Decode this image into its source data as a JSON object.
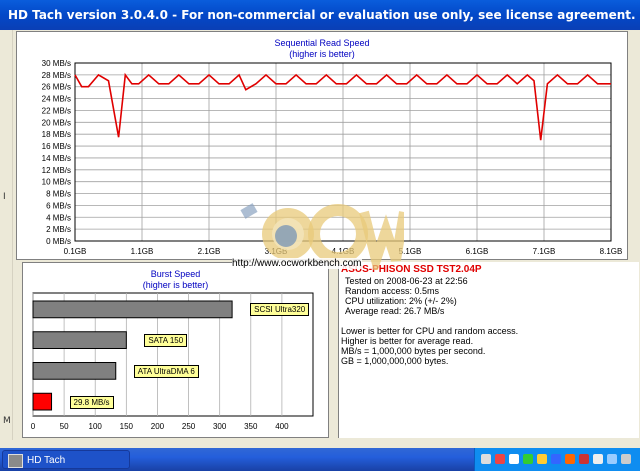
{
  "window": {
    "title": "HD Tach version 3.0.4.0  - For non-commercial or evaluation use only, see license agreement."
  },
  "left_letters": [
    "I",
    "M"
  ],
  "read_chart": {
    "title_line1": "Sequential Read Speed",
    "title_line2": "(higher is better)"
  },
  "burst_chart": {
    "title_line1": "Burst Speed",
    "title_line2": "(higher is better)"
  },
  "info": {
    "drive": "ASUS-PHISON SSD TST2.04P",
    "tested": "Tested on 2008-06-23 at 22:56",
    "random_access": "Random access: 0.5ms",
    "cpu": "CPU utilization: 2% (+/- 2%)",
    "avg_read": "Average read: 26.7 MB/s",
    "note1": "Lower is better for CPU and random access.",
    "note2": "Higher is better for average read.",
    "note3": "MB/s = 1,000,000 bytes per second.",
    "note4": "GB = 1,000,000,000 bytes."
  },
  "watermark": {
    "logo_text": "OCW",
    "url": "http://www.ocworkbench.com"
  },
  "taskbar": {
    "task_label": "HD Tach"
  },
  "colors": {
    "read_line": "#e00000",
    "bar_fill": "#808080",
    "burst_bar": "#ff0000",
    "title_blue": "#0000c0"
  },
  "chart_data": [
    {
      "type": "line",
      "title": "Sequential Read Speed",
      "subtitle": "(higher is better)",
      "ylim": [
        0,
        30
      ],
      "y_ticks": [
        "0 MB/s",
        "2 MB/s",
        "4 MB/s",
        "6 MB/s",
        "8 MB/s",
        "10 MB/s",
        "12 MB/s",
        "14 MB/s",
        "16 MB/s",
        "18 MB/s",
        "20 MB/s",
        "22 MB/s",
        "24 MB/s",
        "26 MB/s",
        "28 MB/s",
        "30 MB/s"
      ],
      "x_ticks": [
        "0.1GB",
        "1.1GB",
        "2.1GB",
        "3.1GB",
        "4.1GB",
        "5.1GB",
        "6.1GB",
        "7.1GB",
        "8.1GB"
      ],
      "xlim": [
        0.1,
        8.1
      ],
      "grid": true,
      "series": [
        {
          "x": [
            0.1,
            0.2,
            0.3,
            0.45,
            0.6,
            0.75,
            0.85,
            0.95,
            1.05,
            1.2,
            1.35,
            1.5,
            1.65,
            1.8,
            1.95,
            2.1,
            2.25,
            2.4,
            2.55,
            2.65,
            2.8,
            2.95,
            3.1,
            3.25,
            3.4,
            3.55,
            3.7,
            3.85,
            4.0,
            4.15,
            4.3,
            4.45,
            4.6,
            4.75,
            4.9,
            5.05,
            5.2,
            5.35,
            5.5,
            5.65,
            5.8,
            5.95,
            6.1,
            6.25,
            6.4,
            6.55,
            6.7,
            6.85,
            6.95,
            7.05,
            7.15,
            7.3,
            7.45,
            7.6,
            7.75,
            7.9,
            8.05,
            8.1
          ],
          "values": [
            28,
            26,
            26,
            28,
            27,
            17.5,
            28,
            26.5,
            26.5,
            28,
            26.5,
            26.5,
            28,
            26.5,
            26.5,
            28,
            26.5,
            26.5,
            28,
            25.5,
            26.5,
            28,
            26.5,
            26.5,
            28,
            26.5,
            26.5,
            28,
            26.5,
            26.5,
            28,
            26.5,
            26.5,
            28,
            26.5,
            26.5,
            28,
            26.5,
            26.5,
            28,
            26.5,
            26.5,
            28,
            26.5,
            26.5,
            28,
            26.5,
            28,
            27,
            17,
            26.5,
            28,
            26.5,
            26.5,
            28,
            26.5,
            26.5,
            26.5
          ]
        }
      ]
    },
    {
      "type": "bar",
      "title": "Burst Speed",
      "subtitle": "(higher is better)",
      "orientation": "horizontal",
      "xlim": [
        0,
        450
      ],
      "x_ticks": [
        "0",
        "50",
        "100",
        "150",
        "200",
        "250",
        "300",
        "350",
        "400"
      ],
      "categories": [
        "SCSI Ultra320",
        "SATA 150",
        "ATA UltraDMA 6",
        "29.8 MB/s"
      ],
      "values": [
        320,
        150,
        133,
        29.8
      ],
      "grid": true
    }
  ]
}
